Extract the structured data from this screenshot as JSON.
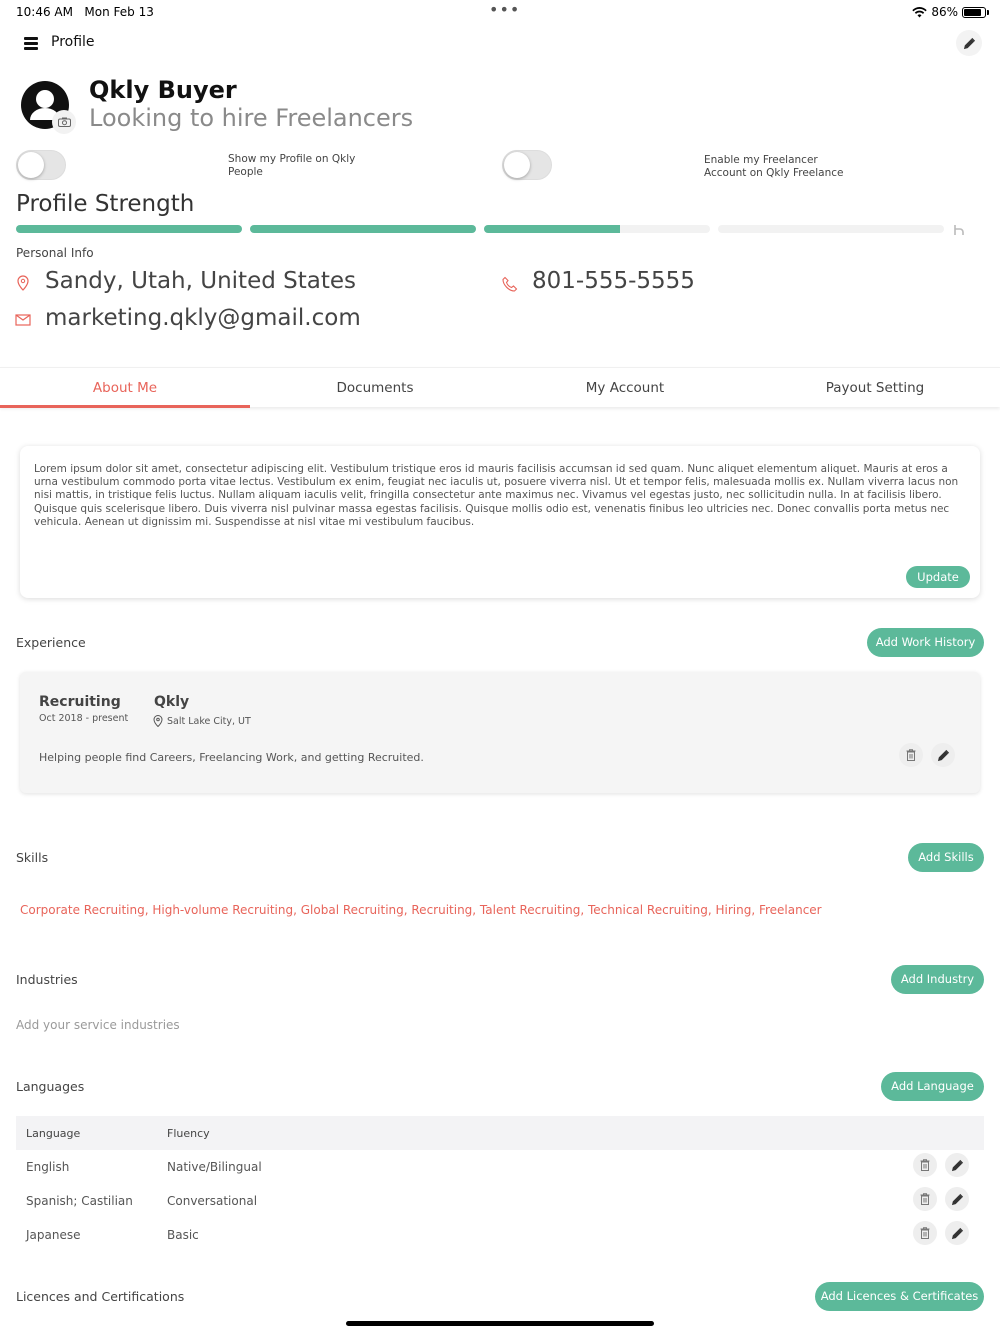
{
  "status_bar": {
    "time": "10:46 AM",
    "date": "Mon Feb 13",
    "battery": "86%",
    "battery_level": 0.86
  },
  "header": {
    "title": "Profile"
  },
  "profile": {
    "name": "Qkly Buyer",
    "tagline": "Looking to hire Freelancers"
  },
  "toggles": [
    {
      "label": "Show my Profile on Qkly People",
      "on": false
    },
    {
      "label": "Enable my Freelancer Account on Qkly Freelance",
      "on": false
    }
  ],
  "strength": {
    "title": "Profile Strength",
    "segments": [
      1,
      1,
      0.6,
      0,
      0
    ]
  },
  "personal_info": {
    "label": "Personal Info",
    "location": "Sandy, Utah, United States",
    "phone": "801-555-5555",
    "email": "marketing.qkly@gmail.com"
  },
  "tabs": [
    {
      "label": "About Me",
      "active": true
    },
    {
      "label": "Documents",
      "active": false
    },
    {
      "label": "My Account",
      "active": false
    },
    {
      "label": "Payout Setting",
      "active": false
    }
  ],
  "about": {
    "text": "Lorem ipsum dolor sit amet, consectetur adipiscing elit. Vestibulum tristique eros id mauris facilisis accumsan id sed quam. Nunc aliquet elementum aliquet. Mauris at eros a urna vestibulum commodo porta vitae lectus. Vestibulum ex enim, feugiat nec iaculis ut, posuere viverra nisl. Ut et tempor felis, malesuada mollis ex. Nullam viverra lacus non nisi mattis, in tristique felis luctus. Nullam aliquam iaculis velit, fringilla consectetur ante maximus nec. Vivamus vel egestas justo, nec sollicitudin nulla. In at facilisis libero. Quisque quis scelerisque libero. Duis viverra nisl pulvinar massa egestas facilisis. Quisque mollis odio est, venenatis finibus leo ultricies nec. Donec convallis porta metus nec vehicula. Aenean ut dignissim mi. Suspendisse at nisl vitae mi vestibulum faucibus.",
    "update_label": "Update"
  },
  "experience": {
    "label": "Experience",
    "add_label": "Add Work History",
    "item": {
      "title": "Recruiting",
      "dates": "Oct 2018 - present",
      "company": "Qkly",
      "location": "Salt Lake City, UT",
      "description": "Helping people find Careers, Freelancing Work, and getting Recruited."
    }
  },
  "skills": {
    "label": "Skills",
    "add_label": "Add Skills",
    "list": "Corporate Recruiting, High-volume Recruiting, Global Recruiting, Recruiting, Talent Recruiting, Technical Recruiting, Hiring, Freelancer"
  },
  "industries": {
    "label": "Industries",
    "add_label": "Add Industry",
    "placeholder": "Add your service industries"
  },
  "languages": {
    "label": "Languages",
    "add_label": "Add Language",
    "headers": [
      "Language",
      "Fluency"
    ],
    "rows": [
      {
        "language": "English",
        "fluency": "Native/Bilingual"
      },
      {
        "language": "Spanish; Castilian",
        "fluency": "Conversational"
      },
      {
        "language": "Japanese",
        "fluency": "Basic"
      }
    ]
  },
  "certifications": {
    "label": "Licences and Certifications",
    "add_label": "Add Licences & Certificates"
  },
  "colors": {
    "accent": "#5cb99a",
    "active_tab": "#e8645a",
    "skills": "#e8645a"
  }
}
